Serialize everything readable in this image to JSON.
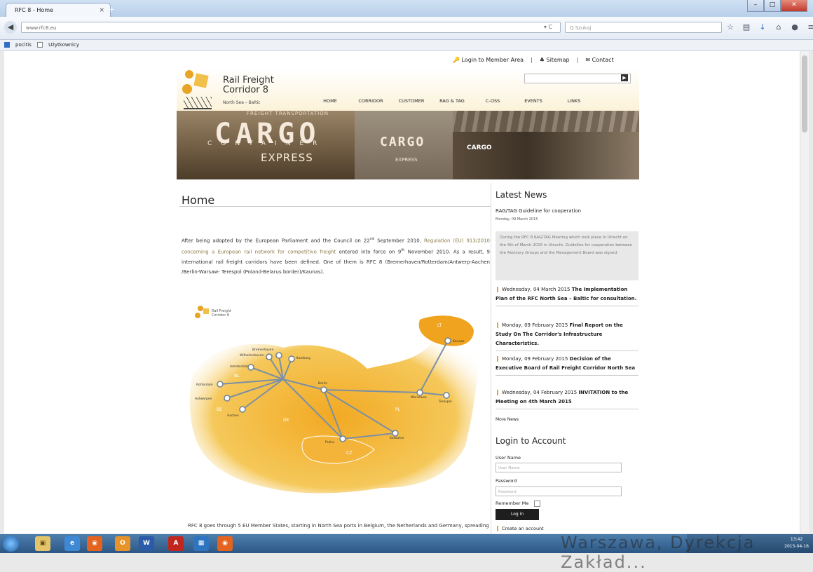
{
  "browser": {
    "tab_title": "RFC 8 - Home",
    "tab_close": "×",
    "new_tab": "+",
    "url": "www.rfc8.eu",
    "reload": "▾ C",
    "search_placeholder": "Q Szukaj",
    "bookmarks": [
      "pocitis",
      "Użytkownicy"
    ]
  },
  "page": {
    "top_links": {
      "login": "Login to Member Area",
      "sep1": "|",
      "sitemap": "Sitemap",
      "sep2": "|",
      "contact": "Contact"
    },
    "brand": {
      "line1": "Rail Freight",
      "line2": "Corridor 8",
      "tagline": "North Sea – Baltic"
    },
    "nav": [
      "HOME",
      "CORRIDOR",
      "CUSTOMER",
      "RAG & TAG",
      "C-OSS",
      "EVENTS",
      "LINKS"
    ],
    "banner": {
      "small_top": "FREIGHT TRANSPORTATION",
      "cargo": "CARGO",
      "container": "CONTAINER",
      "express": "EXPRESS",
      "cargo2": "CARGO",
      "express2": "EXPRESS",
      "cargo3": "CARGO"
    },
    "title": "Home",
    "intro": {
      "p1": "After being adopted by the European Parliament and the Council on 22",
      "sup": "nd",
      "p2": " September 2010, ",
      "regulation": "Regulation (EU) 913/2010 concerning a European rail network for competitive freight",
      "p3": " entered into force on 9",
      "sup2": "th",
      "p4": " November 2010. As a result, 9 international rail freight corridors have been defined. One of them is RFC 8 (Bremerhaven/Rotterdam/Antwerp-Aachen /Berlin-Warsaw- Terespol (Poland-Belarus border)/Kaunas)."
    },
    "map": {
      "logo_line1": "Rail Freight",
      "logo_line2": "Corridor 8",
      "cities": [
        "Bremerhaven",
        "Wilhelmshaven",
        "Hamburg",
        "Amsterdam",
        "Rotterdam",
        "Antwerpen",
        "Aachen",
        "Berlin",
        "Warszawa",
        "Terespol",
        "Kaunas",
        "Praha",
        "Katowice"
      ],
      "countries": [
        "NL",
        "BE",
        "DE",
        "PL",
        "CZ",
        "LT"
      ]
    },
    "bottom_text": "RFC 8 goes through 5 EU Member States, starting in North Sea ports in Belgium, the Netherlands and Germany, spreading"
  },
  "sidebar": {
    "news_heading": "Latest News",
    "first_news_title": "RAG/TAG Guideline for cooperation",
    "first_news_date": "Monday, 09 March 2015",
    "first_news_body": "During the RFC 8 RAG/TAG Meeting which took place in Utrecht on the 4th of March 2015 in Utrecht, Guideline for cooperation between the Advisory Groups and the Management Board was signed.",
    "items": [
      {
        "date": "Wednesday, 04 March 2015",
        "title": "The Implementation Plan of the RFC North Sea – Baltic for consultation."
      },
      {
        "date": "Monday, 09 February 2015",
        "title": "Final Report on the Study On The Corridor's Infrastructure Characteristics."
      },
      {
        "date": "Monday, 09 February 2015",
        "title": "Decision of the Executive Board of Rail Freight Corridor North Sea"
      },
      {
        "date": "Wednesday, 04 February 2015",
        "title": "INVITATION to the Meeting on 4th March 2015"
      }
    ],
    "more_news": "More News",
    "login_heading": "Login to Account",
    "user_label": "User Name",
    "user_placeholder": "User Name",
    "pass_label": "Password",
    "pass_placeholder": "Password",
    "remember": "Remember Me",
    "login_button": "Log in",
    "create_account": "Create an account"
  },
  "taskbar": {
    "watermark": "Warszawa, Dyrekcja Zakład...",
    "clock_time": "13:42",
    "clock_date": "2015-04-16"
  }
}
